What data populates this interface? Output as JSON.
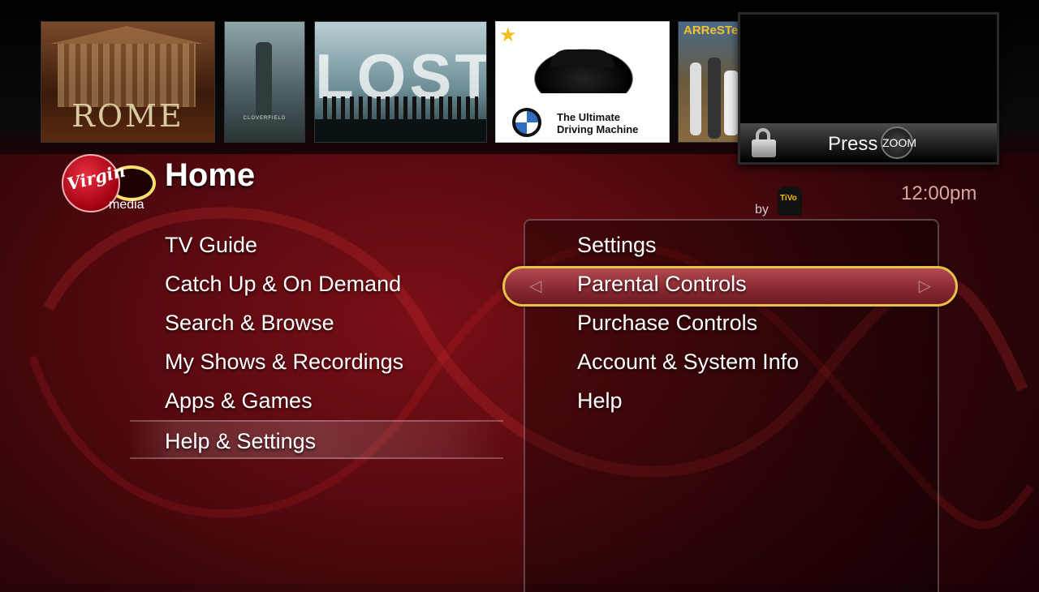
{
  "thumbnails": [
    {
      "title": "ROME"
    },
    {
      "title": "CLOVERFIELD"
    },
    {
      "title": "LOST"
    },
    {
      "title": "The Ultimate Driving Machine",
      "line1": "The Ultimate",
      "line2": "Driving Machine",
      "starred": true
    },
    {
      "title": "ARReSTe"
    }
  ],
  "preview": {
    "press_label": "Press",
    "zoom_label": "ZOOM"
  },
  "header": {
    "title": "Home",
    "brand": "Virgin media",
    "brand_word1": "Virgin",
    "brand_word2": "media",
    "by_label": "by",
    "clock": "12:00pm"
  },
  "left_menu": {
    "items": [
      "TV Guide",
      "Catch Up & On Demand",
      "Search & Browse",
      "My Shows & Recordings",
      "Apps & Games",
      "Help & Settings"
    ],
    "active_index": 5
  },
  "right_menu": {
    "items": [
      "Settings",
      "Parental Controls",
      "Purchase Controls",
      "Account & System Info",
      "Help"
    ],
    "selected_index": 1
  },
  "colors": {
    "accent": "#e8c04a",
    "background": "#5a0a10",
    "highlight": "#8a2a32"
  }
}
